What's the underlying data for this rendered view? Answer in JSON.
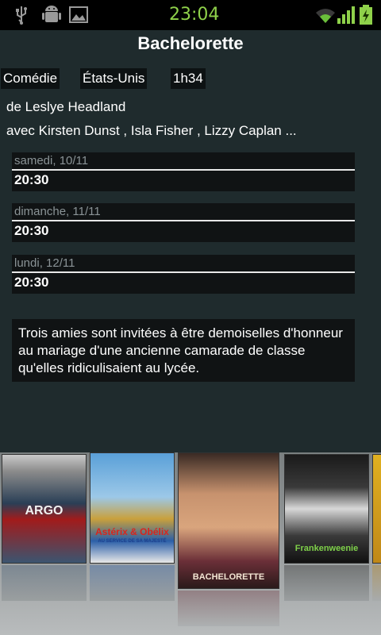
{
  "status_bar": {
    "time": "23:04"
  },
  "movie": {
    "title": "Bachelorette",
    "tags": [
      "Comédie",
      "États-Unis",
      "1h34"
    ],
    "director_line": "de Leslye Headland",
    "cast_line": "avec Kirsten Dunst , Isla Fisher , Lizzy Caplan ...",
    "showtimes": [
      {
        "day": "samedi, 10/11",
        "time": "20:30"
      },
      {
        "day": "dimanche, 11/11",
        "time": "20:30"
      },
      {
        "day": "lundi, 12/11",
        "time": "20:30"
      }
    ],
    "synopsis": "Trois amies sont invitées à être demoiselles d'honneur au mariage d'une ancienne camarade de classe qu'elles ridiculisaient au lycée."
  },
  "carousel": {
    "posters": [
      {
        "icon": "poster-argo",
        "title": "ARGO"
      },
      {
        "icon": "poster-asterix-obelix",
        "title": "Astérix & Obélix",
        "subtitle": "AU SERVICE DE SA MAJESTÉ"
      },
      {
        "icon": "poster-bachelorette",
        "title": "BACHELORETTE"
      },
      {
        "icon": "poster-frankenweenie",
        "title": "Frankenweenie"
      },
      {
        "icon": "poster-partial"
      }
    ]
  }
}
